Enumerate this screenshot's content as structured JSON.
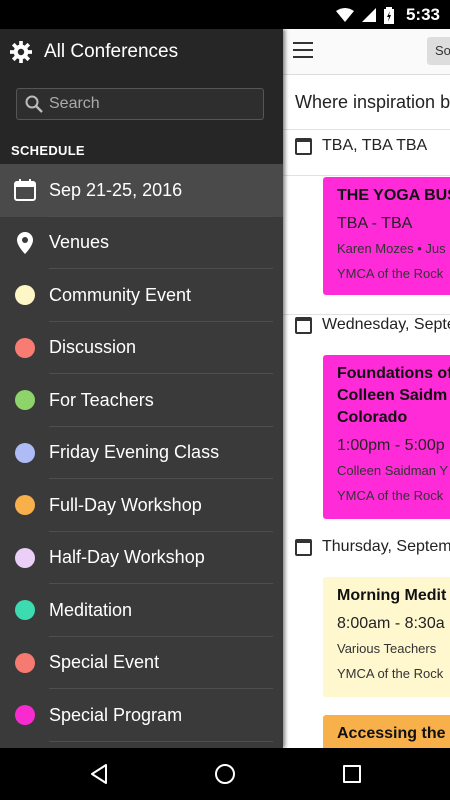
{
  "status_bar": {
    "time": "5:33"
  },
  "drawer": {
    "title": "All Conferences",
    "search_placeholder": "Search",
    "section_label": "SCHEDULE",
    "items": [
      {
        "label": "Sep 21-25, 2016",
        "icon": "calendar-icon"
      },
      {
        "label": "Venues",
        "icon": "location-pin-icon"
      },
      {
        "label": "Community Event",
        "color": "#fff6c8"
      },
      {
        "label": "Discussion",
        "color": "#f87c72"
      },
      {
        "label": "For Teachers",
        "color": "#8fd36b"
      },
      {
        "label": "Friday Evening Class",
        "color": "#aebbf5"
      },
      {
        "label": "Full-Day Workshop",
        "color": "#f7b04a"
      },
      {
        "label": "Half-Day Workshop",
        "color": "#eccff7"
      },
      {
        "label": "Meditation",
        "color": "#3ddbb0"
      },
      {
        "label": "Special Event",
        "color": "#f57a72"
      },
      {
        "label": "Special Program",
        "color": "#f72bd0"
      }
    ]
  },
  "main": {
    "toolbar_button": "So",
    "tagline": "Where inspiration b",
    "sections": [
      {
        "date": "TBA, TBA TBA"
      },
      {
        "date": "Wednesday, Septe"
      },
      {
        "date": "Thursday, Septem"
      }
    ],
    "cards": [
      {
        "title": "THE YOGA BUS",
        "time": "TBA - TBA",
        "people": "Karen Mozes • Jus",
        "venue": "YMCA of the Rock"
      },
      {
        "title_line1": "Foundations of",
        "title_line2": "Colleen Saidm",
        "title_line3": "Colorado",
        "time": "1:00pm - 5:00p",
        "people": "Colleen Saidman Y",
        "venue": "YMCA of the Rock"
      },
      {
        "title": "Morning Medit",
        "time": "8:00am - 8:30a",
        "people": "Various Teachers",
        "venue": "YMCA of the Rock"
      },
      {
        "title": "Accessing the"
      }
    ]
  }
}
